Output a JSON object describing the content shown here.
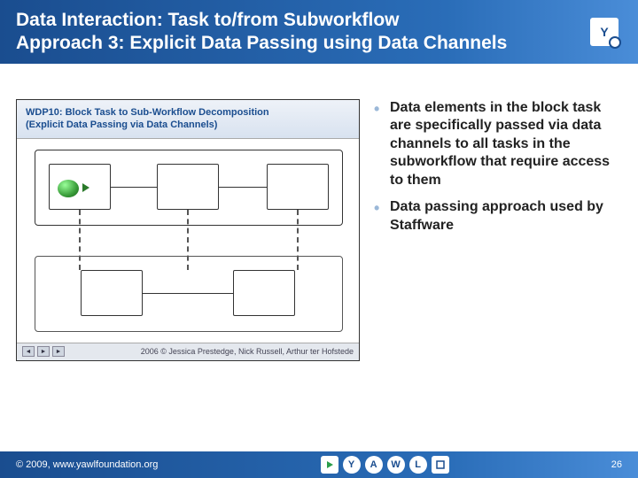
{
  "header": {
    "title_line1": "Data Interaction: Task to/from Subworkflow",
    "title_line2": "Approach 3: Explicit Data Passing using Data Channels",
    "logo_text": "Y"
  },
  "diagram": {
    "title_line1": "WDP10: Block Task to Sub-Workflow Decomposition",
    "title_line2": "(Explicit Data Passing via Data Channels)",
    "credits": "2006 © Jessica Prestedge, Nick Russell, Arthur ter Hofstede",
    "controls": {
      "prev": "◄",
      "play": "►",
      "next": "►"
    }
  },
  "bullets": [
    "Data elements in the block task are specifically passed via data channels to all tasks in the subworkflow that require access to them",
    "Data passing approach used by Staffware"
  ],
  "footer": {
    "copyright": "© 2009, www.yawlfoundation.org",
    "page": "26",
    "icons": {
      "y": "Y",
      "a": "A",
      "w": "W",
      "l": "L"
    }
  }
}
